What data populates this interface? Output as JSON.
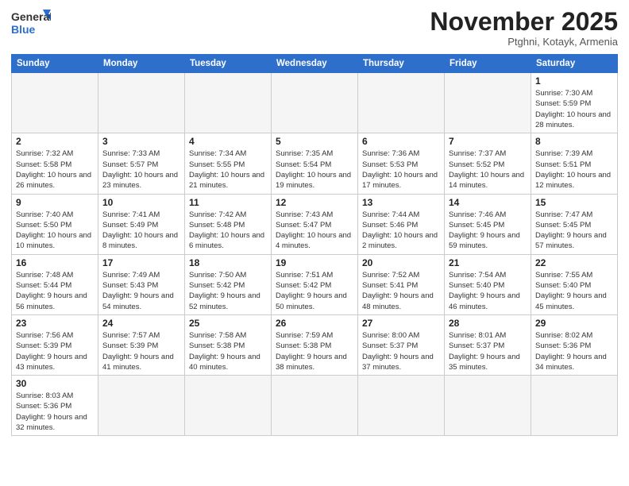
{
  "header": {
    "logo_general": "General",
    "logo_blue": "Blue",
    "month_title": "November 2025",
    "location": "Ptghni, Kotayk, Armenia"
  },
  "weekdays": [
    "Sunday",
    "Monday",
    "Tuesday",
    "Wednesday",
    "Thursday",
    "Friday",
    "Saturday"
  ],
  "weeks": [
    [
      {
        "day": "",
        "info": ""
      },
      {
        "day": "",
        "info": ""
      },
      {
        "day": "",
        "info": ""
      },
      {
        "day": "",
        "info": ""
      },
      {
        "day": "",
        "info": ""
      },
      {
        "day": "",
        "info": ""
      },
      {
        "day": "1",
        "info": "Sunrise: 7:30 AM\nSunset: 5:59 PM\nDaylight: 10 hours\nand 28 minutes."
      }
    ],
    [
      {
        "day": "2",
        "info": "Sunrise: 7:32 AM\nSunset: 5:58 PM\nDaylight: 10 hours\nand 26 minutes."
      },
      {
        "day": "3",
        "info": "Sunrise: 7:33 AM\nSunset: 5:57 PM\nDaylight: 10 hours\nand 23 minutes."
      },
      {
        "day": "4",
        "info": "Sunrise: 7:34 AM\nSunset: 5:55 PM\nDaylight: 10 hours\nand 21 minutes."
      },
      {
        "day": "5",
        "info": "Sunrise: 7:35 AM\nSunset: 5:54 PM\nDaylight: 10 hours\nand 19 minutes."
      },
      {
        "day": "6",
        "info": "Sunrise: 7:36 AM\nSunset: 5:53 PM\nDaylight: 10 hours\nand 17 minutes."
      },
      {
        "day": "7",
        "info": "Sunrise: 7:37 AM\nSunset: 5:52 PM\nDaylight: 10 hours\nand 14 minutes."
      },
      {
        "day": "8",
        "info": "Sunrise: 7:39 AM\nSunset: 5:51 PM\nDaylight: 10 hours\nand 12 minutes."
      }
    ],
    [
      {
        "day": "9",
        "info": "Sunrise: 7:40 AM\nSunset: 5:50 PM\nDaylight: 10 hours\nand 10 minutes."
      },
      {
        "day": "10",
        "info": "Sunrise: 7:41 AM\nSunset: 5:49 PM\nDaylight: 10 hours\nand 8 minutes."
      },
      {
        "day": "11",
        "info": "Sunrise: 7:42 AM\nSunset: 5:48 PM\nDaylight: 10 hours\nand 6 minutes."
      },
      {
        "day": "12",
        "info": "Sunrise: 7:43 AM\nSunset: 5:47 PM\nDaylight: 10 hours\nand 4 minutes."
      },
      {
        "day": "13",
        "info": "Sunrise: 7:44 AM\nSunset: 5:46 PM\nDaylight: 10 hours\nand 2 minutes."
      },
      {
        "day": "14",
        "info": "Sunrise: 7:46 AM\nSunset: 5:45 PM\nDaylight: 9 hours\nand 59 minutes."
      },
      {
        "day": "15",
        "info": "Sunrise: 7:47 AM\nSunset: 5:45 PM\nDaylight: 9 hours\nand 57 minutes."
      }
    ],
    [
      {
        "day": "16",
        "info": "Sunrise: 7:48 AM\nSunset: 5:44 PM\nDaylight: 9 hours\nand 56 minutes."
      },
      {
        "day": "17",
        "info": "Sunrise: 7:49 AM\nSunset: 5:43 PM\nDaylight: 9 hours\nand 54 minutes."
      },
      {
        "day": "18",
        "info": "Sunrise: 7:50 AM\nSunset: 5:42 PM\nDaylight: 9 hours\nand 52 minutes."
      },
      {
        "day": "19",
        "info": "Sunrise: 7:51 AM\nSunset: 5:42 PM\nDaylight: 9 hours\nand 50 minutes."
      },
      {
        "day": "20",
        "info": "Sunrise: 7:52 AM\nSunset: 5:41 PM\nDaylight: 9 hours\nand 48 minutes."
      },
      {
        "day": "21",
        "info": "Sunrise: 7:54 AM\nSunset: 5:40 PM\nDaylight: 9 hours\nand 46 minutes."
      },
      {
        "day": "22",
        "info": "Sunrise: 7:55 AM\nSunset: 5:40 PM\nDaylight: 9 hours\nand 45 minutes."
      }
    ],
    [
      {
        "day": "23",
        "info": "Sunrise: 7:56 AM\nSunset: 5:39 PM\nDaylight: 9 hours\nand 43 minutes."
      },
      {
        "day": "24",
        "info": "Sunrise: 7:57 AM\nSunset: 5:39 PM\nDaylight: 9 hours\nand 41 minutes."
      },
      {
        "day": "25",
        "info": "Sunrise: 7:58 AM\nSunset: 5:38 PM\nDaylight: 9 hours\nand 40 minutes."
      },
      {
        "day": "26",
        "info": "Sunrise: 7:59 AM\nSunset: 5:38 PM\nDaylight: 9 hours\nand 38 minutes."
      },
      {
        "day": "27",
        "info": "Sunrise: 8:00 AM\nSunset: 5:37 PM\nDaylight: 9 hours\nand 37 minutes."
      },
      {
        "day": "28",
        "info": "Sunrise: 8:01 AM\nSunset: 5:37 PM\nDaylight: 9 hours\nand 35 minutes."
      },
      {
        "day": "29",
        "info": "Sunrise: 8:02 AM\nSunset: 5:36 PM\nDaylight: 9 hours\nand 34 minutes."
      }
    ],
    [
      {
        "day": "30",
        "info": "Sunrise: 8:03 AM\nSunset: 5:36 PM\nDaylight: 9 hours\nand 32 minutes."
      },
      {
        "day": "",
        "info": ""
      },
      {
        "day": "",
        "info": ""
      },
      {
        "day": "",
        "info": ""
      },
      {
        "day": "",
        "info": ""
      },
      {
        "day": "",
        "info": ""
      },
      {
        "day": "",
        "info": ""
      }
    ]
  ]
}
